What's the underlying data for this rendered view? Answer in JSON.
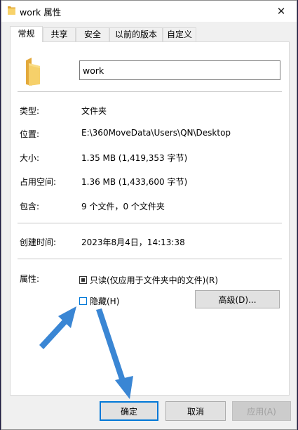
{
  "window": {
    "title": "work 属性",
    "close_glyph": "✕"
  },
  "tabs": [
    {
      "label": "常规",
      "active": true
    },
    {
      "label": "共享"
    },
    {
      "label": "安全"
    },
    {
      "label": "以前的版本"
    },
    {
      "label": "自定义"
    }
  ],
  "general": {
    "name_value": "work",
    "rows": [
      {
        "label": "类型:",
        "value": "文件夹"
      },
      {
        "label": "位置:",
        "value": "E:\\360MoveData\\Users\\QN\\Desktop"
      },
      {
        "label": "大小:",
        "value": "1.35 MB (1,419,353 字节)"
      },
      {
        "label": "占用空间:",
        "value": "1.36 MB (1,433,600 字节)"
      },
      {
        "label": "包含:",
        "value": "9 个文件，0 个文件夹"
      },
      {
        "label": "创建时间:",
        "value": "2023年8月4日，14:13:38"
      }
    ],
    "attributes_label": "属性:",
    "readonly_label": "只读(仅应用于文件夹中的文件)(R)",
    "hidden_label": "隐藏(H)",
    "advanced_label": "高级(D)..."
  },
  "buttons": {
    "ok": "确定",
    "cancel": "取消",
    "apply": "应用(A)"
  },
  "colors": {
    "accent": "#0078d7",
    "annotation_arrow": "#3a86d4",
    "folder": "#f3c64f"
  },
  "icons": {
    "folder": "folder-icon",
    "close": "close-icon"
  }
}
